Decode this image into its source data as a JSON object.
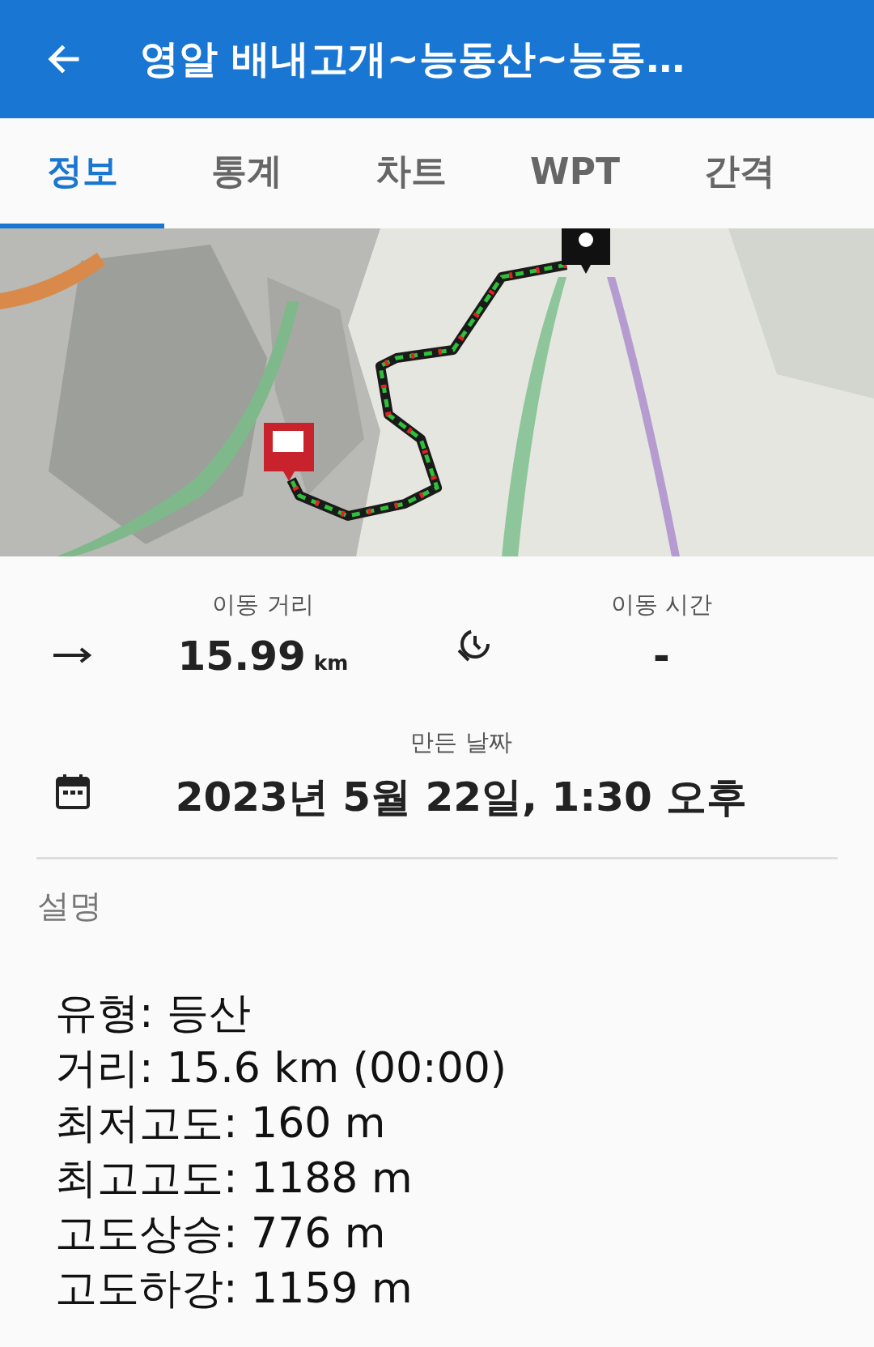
{
  "header": {
    "title": "영알 배내고개~능동산~능동…"
  },
  "tabs": [
    {
      "label": "정보",
      "selected": true
    },
    {
      "label": "통계",
      "selected": false
    },
    {
      "label": "차트",
      "selected": false
    },
    {
      "label": "WPT",
      "selected": false
    },
    {
      "label": "간격",
      "selected": false
    }
  ],
  "stats": [
    {
      "kind": "distance",
      "label": "이동 거리",
      "value": "15.99",
      "unit": "km"
    },
    {
      "kind": "time",
      "label": "이동 시간",
      "value": "-"
    }
  ],
  "created": {
    "label": "만든 날짜",
    "value": "2023년 5월 22일, 1:30 오후"
  },
  "description": {
    "heading": "설명",
    "lines": [
      "유형: 등산",
      "거리: 15.6 km (00:00)",
      "최저고도: 160 m",
      "최고고도: 1188 m",
      "고도상승: 776 m",
      "고도하강: 1159 m"
    ]
  }
}
